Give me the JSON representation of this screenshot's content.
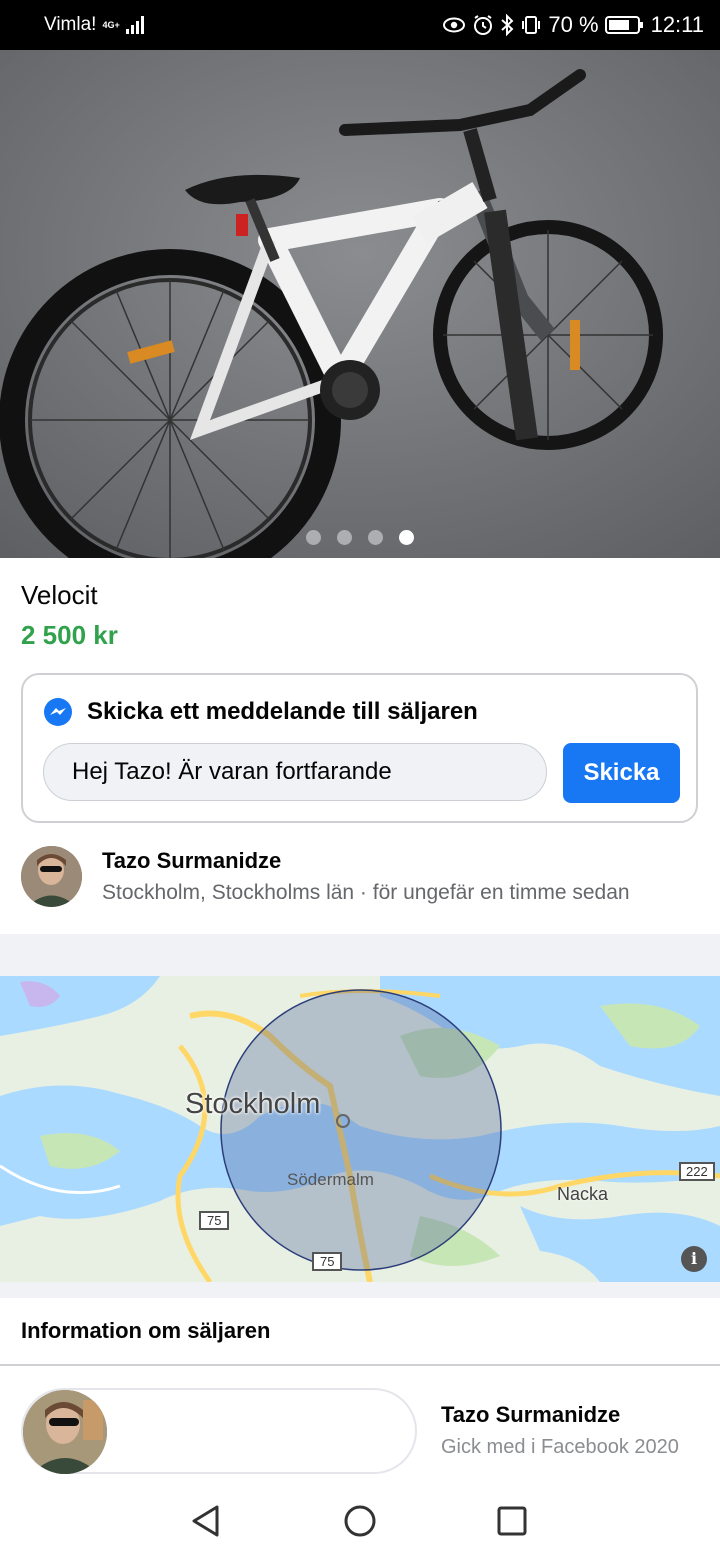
{
  "status_bar": {
    "carrier": "Vimla!",
    "network": "4G+",
    "battery": "70 %",
    "time": "12:11",
    "icons": [
      "eye-icon",
      "alarm-icon",
      "bluetooth-icon",
      "vibrate-icon",
      "battery-icon"
    ]
  },
  "photo": {
    "image_count": 4,
    "active_index": 3
  },
  "listing": {
    "title": "Velocit",
    "price": "2 500 kr"
  },
  "message": {
    "icon": "messenger-icon",
    "heading": "Skicka ett meddelande till säljaren",
    "input_value": "Hej Tazo! Är varan fortfarande",
    "send_label": "Skicka"
  },
  "seller": {
    "name": "Tazo Surmanidze",
    "meta": "Stockholm, Stockholms län · för ungefär en timme sedan"
  },
  "map": {
    "city_label": "Stockholm",
    "district_label": "Södermalm",
    "suburb_label": "Nacka",
    "road_75_a": "75",
    "road_75_b": "75",
    "road_222": "222",
    "info_icon": "i"
  },
  "seller_info": {
    "heading": "Information om säljaren",
    "name": "Tazo Surmanidze",
    "joined": "Gick med i Facebook 2020"
  },
  "nav": {
    "back": "back-icon",
    "home": "home-icon",
    "recents": "recents-icon"
  },
  "colors": {
    "price_green": "#31a24c",
    "accent_blue": "#1877f2",
    "map_water": "#aadaff",
    "map_land": "#e8f0e3"
  }
}
